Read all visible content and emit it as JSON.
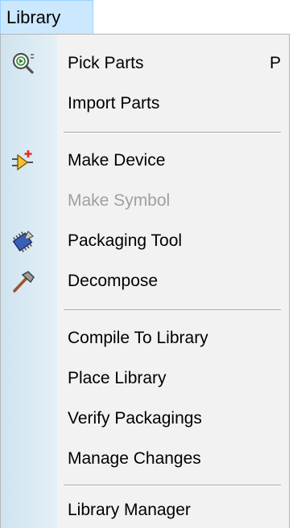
{
  "menubar": {
    "library_label": "Library"
  },
  "menu": {
    "items": [
      {
        "label": "Pick Parts",
        "shortcut": "P",
        "icon": "pick-parts-icon",
        "enabled": true
      },
      {
        "label": "Import Parts",
        "enabled": true
      },
      {
        "label": "Make Device",
        "icon": "make-device-icon",
        "enabled": true
      },
      {
        "label": "Make Symbol",
        "enabled": false
      },
      {
        "label": "Packaging Tool",
        "icon": "packaging-tool-icon",
        "enabled": true
      },
      {
        "label": "Decompose",
        "icon": "decompose-icon",
        "enabled": true
      },
      {
        "label": "Compile To Library",
        "enabled": true
      },
      {
        "label": "Place Library",
        "enabled": true
      },
      {
        "label": "Verify Packagings",
        "enabled": true
      },
      {
        "label": "Manage Changes",
        "enabled": true
      },
      {
        "label": "Library Manager",
        "enabled": true
      }
    ]
  },
  "colors": {
    "menubar_highlight": "#cce8ff",
    "menu_background": "#f2f2f2",
    "icon_gutter": "#d9e9f3",
    "disabled_text": "#a0a0a0"
  }
}
